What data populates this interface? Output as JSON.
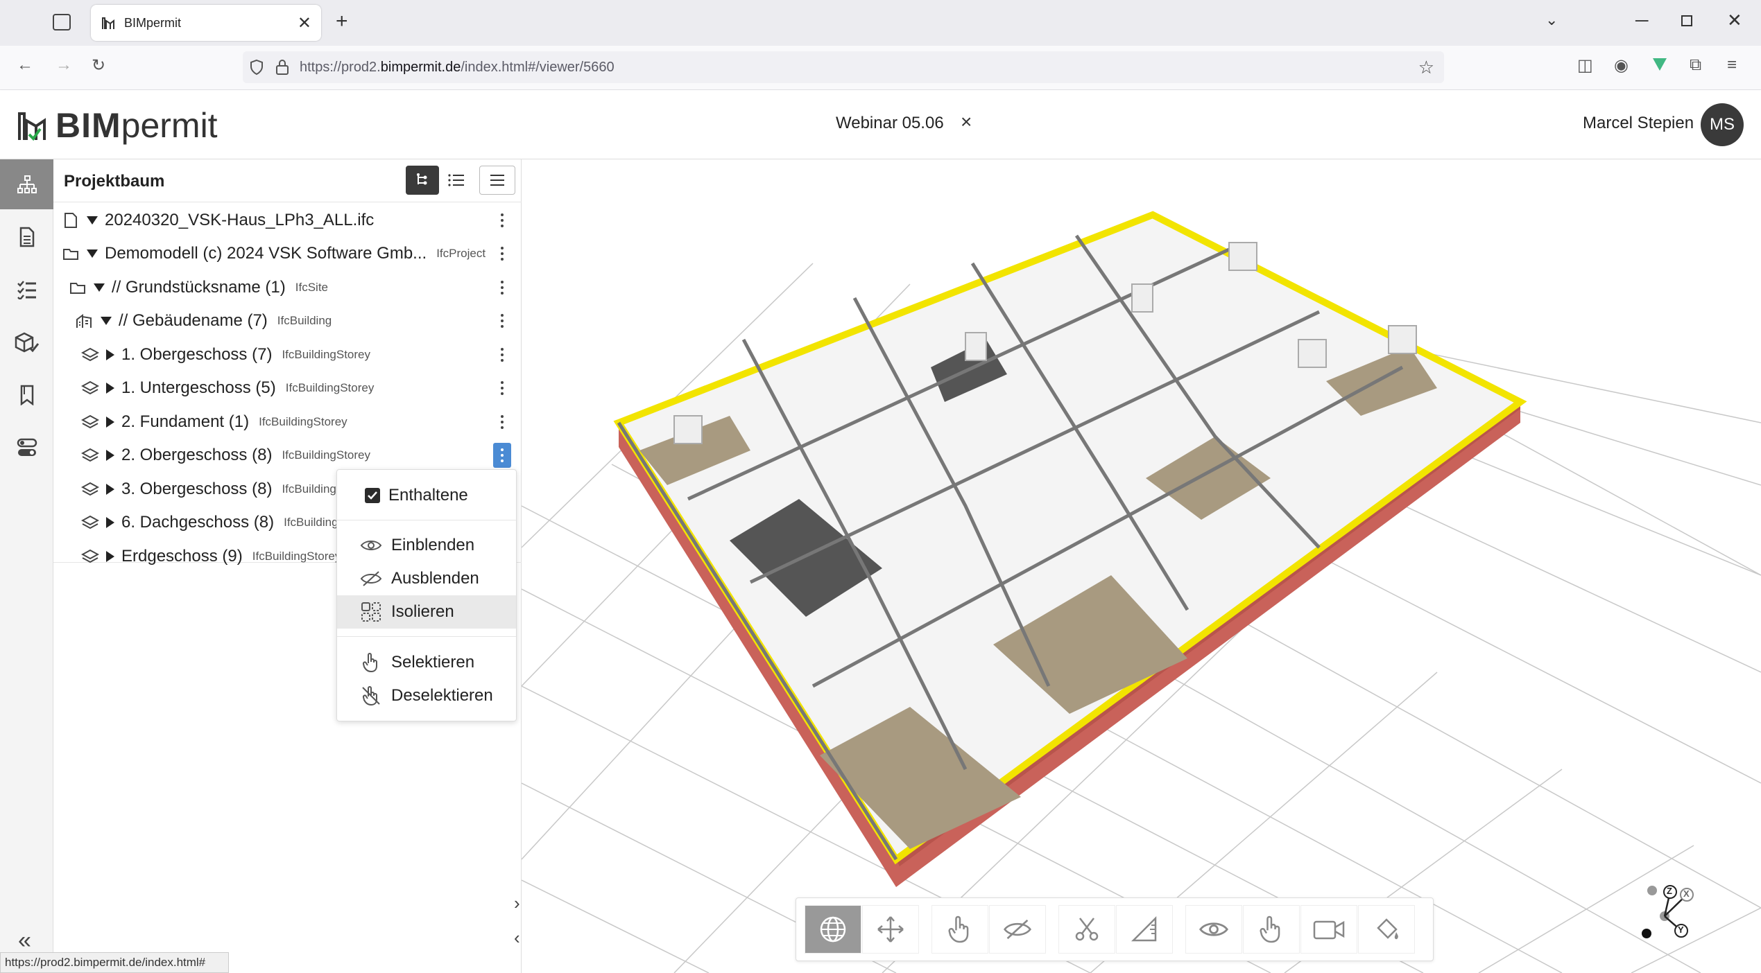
{
  "browser": {
    "tab_title": "BIMpermit",
    "url_prefix": "https://prod2.",
    "url_domain": "bimpermit.de",
    "url_suffix": "/index.html#/viewer/5660",
    "status_url": "https://prod2.bimpermit.de/index.html#"
  },
  "app": {
    "logo_bold": "BIM",
    "logo_light": "permit",
    "project_name": "Webinar 05.06",
    "close_symbol": "×",
    "user_name": "Marcel Stepien",
    "user_initials": "MS"
  },
  "rail": {
    "items": [
      "hierarchy-icon",
      "document-icon",
      "checklist-icon",
      "model-check-icon",
      "bookmark-icon",
      "toggles-icon"
    ]
  },
  "panel": {
    "title": "Projektbaum",
    "rows": [
      {
        "label": "20240320_VSK-Haus_LPh3_ALL.ifc",
        "tag": "",
        "icon": "file-icon",
        "expanded": true
      },
      {
        "label": "Demomodell (c) 2024 VSK Software Gmb...",
        "tag": "IfcProject",
        "icon": "folder-icon",
        "expanded": true
      },
      {
        "label": "// Grundstücksname (1)",
        "tag": "IfcSite",
        "icon": "folder-icon",
        "expanded": true
      },
      {
        "label": "// Gebäudename (7)",
        "tag": "IfcBuilding",
        "icon": "building-icon",
        "expanded": true
      },
      {
        "label": "1. Obergeschoss (7)",
        "tag": "IfcBuildingStorey",
        "icon": "layers-icon",
        "expanded": false
      },
      {
        "label": "1. Untergeschoss (5)",
        "tag": "IfcBuildingStorey",
        "icon": "layers-icon",
        "expanded": false
      },
      {
        "label": "2. Fundament (1)",
        "tag": "IfcBuildingStorey",
        "icon": "layers-icon",
        "expanded": false
      },
      {
        "label": "2. Obergeschoss (8)",
        "tag": "IfcBuildingStorey",
        "icon": "layers-icon",
        "expanded": false
      },
      {
        "label": "3. Obergeschoss (8)",
        "tag": "IfcBuildingS",
        "icon": "layers-icon",
        "expanded": false
      },
      {
        "label": "6. Dachgeschoss (8)",
        "tag": "IfcBuildingS",
        "icon": "layers-icon",
        "expanded": false
      },
      {
        "label": "Erdgeschoss (9)",
        "tag": "IfcBuildingStorey",
        "icon": "layers-icon",
        "expanded": false
      }
    ]
  },
  "context_menu": {
    "contained_label": "Enthaltene",
    "contained_checked": true,
    "show_label": "Einblenden",
    "hide_label": "Ausblenden",
    "isolate_label": "Isolieren",
    "select_label": "Selektieren",
    "deselect_label": "Deselektieren"
  },
  "toolbar": {
    "buttons": [
      "orbit-globe-icon",
      "pan-arrows-icon",
      "select-hand-icon",
      "hide-eye-icon",
      "section-cut-icon",
      "measure-ruler-icon",
      "visibility-eye-icon",
      "pick-hand-icon",
      "camera-icon",
      "paint-bucket-icon"
    ]
  },
  "axis": {
    "z": "Z",
    "x": "X",
    "y": "Y"
  },
  "colors": {
    "accent": "#4b8bd4",
    "dark": "#3a3a3a",
    "wall_yellow": "#f2e400",
    "facade_red": "#c9625a",
    "floor": "#a89a80"
  }
}
